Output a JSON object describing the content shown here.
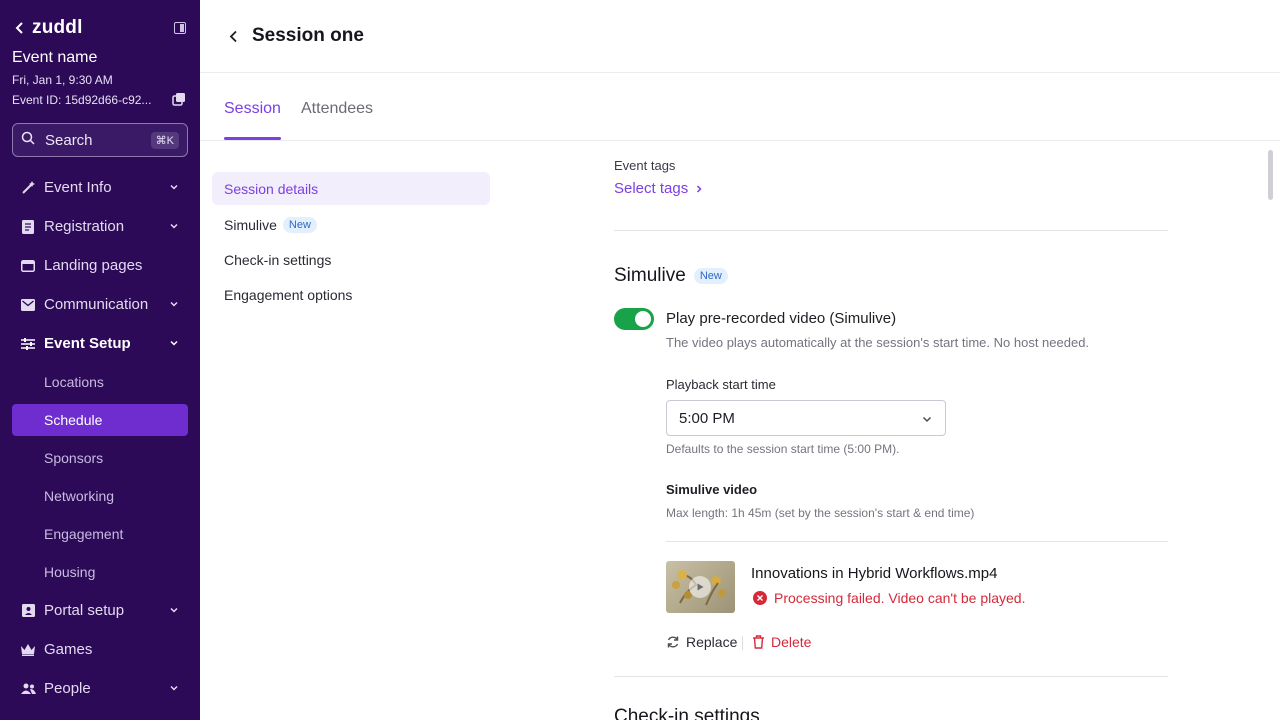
{
  "sidebar": {
    "brand": "zuddl",
    "event_name": "Event name",
    "event_date": "Fri, Jan 1, 9:30 AM",
    "event_id": "Event ID: 15d92d66-c92...",
    "search": {
      "label": "Search",
      "shortcut": "⌘K"
    },
    "nav": [
      {
        "label": "Event Info",
        "icon": "wand-icon"
      },
      {
        "label": "Registration",
        "icon": "form-icon"
      },
      {
        "label": "Landing pages",
        "icon": "browser-icon"
      },
      {
        "label": "Communication",
        "icon": "mail-icon"
      },
      {
        "label": "Event Setup",
        "icon": "sliders-icon"
      },
      {
        "label": "Portal setup",
        "icon": "portal-icon"
      },
      {
        "label": "Games",
        "icon": "crown-icon"
      },
      {
        "label": "People",
        "icon": "people-icon"
      }
    ],
    "event_setup_children": [
      "Locations",
      "Schedule",
      "Sponsors",
      "Networking",
      "Engagement",
      "Housing"
    ],
    "selected_child": "Schedule"
  },
  "header": {
    "title": "Session one"
  },
  "tabs": [
    {
      "label": "Session",
      "active": true
    },
    {
      "label": "Attendees",
      "active": false
    }
  ],
  "subnav": {
    "items": [
      "Session details",
      "Simulive",
      "Check-in settings",
      "Engagement options"
    ],
    "badge_new": "New"
  },
  "content": {
    "event_tags_label": "Event tags",
    "select_tags": "Select tags",
    "simulive_title": "Simulive",
    "simulive_badge": "New",
    "toggle_label": "Play pre-recorded video (Simulive)",
    "toggle_on": true,
    "toggle_help": "The video plays automatically at the session's start time. No host needed.",
    "playback_label": "Playback start time",
    "playback_value": "5:00 PM",
    "playback_help": "Defaults to the session start time (5:00 PM).",
    "video_label": "Simulive video",
    "video_help": "Max length: 1h 45m (set by the session's start & end time)",
    "file_name": "Innovations in Hybrid Workflows.mp4",
    "file_error": "Processing failed. Video can't be played.",
    "replace_label": "Replace",
    "delete_label": "Delete",
    "next_section": "Check-in settings"
  },
  "colors": {
    "sidebar_bg": "#2c0a57",
    "accent": "#7b3fe4",
    "selected_nav": "#6f2dcf",
    "toggle_on": "#18a34a",
    "error": "#d62839"
  }
}
